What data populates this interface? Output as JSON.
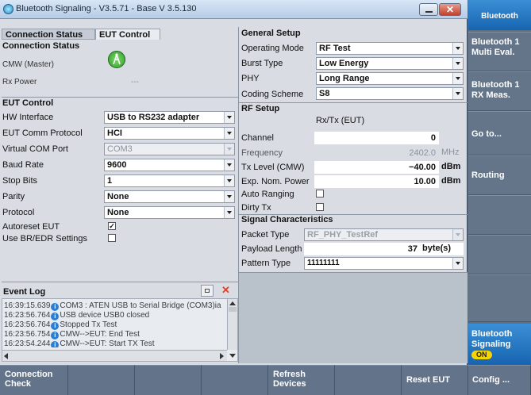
{
  "window": {
    "title": "Bluetooth Signaling  - V3.5.71 - Base V 3.5.130"
  },
  "tabs": [
    {
      "label": "Connection Status"
    },
    {
      "label": "EUT Control"
    }
  ],
  "connection_status": {
    "heading": "Connection Status",
    "cmw_label": "CMW (Master)",
    "rx_power_label": "Rx Power",
    "rx_power_value": "---"
  },
  "eut_control": {
    "heading": "EUT Control",
    "fields": [
      {
        "label": "HW Interface",
        "value": "USB to RS232 adapter"
      },
      {
        "label": "EUT Comm Protocol",
        "value": "HCI"
      },
      {
        "label": "Virtual COM Port",
        "value": "COM3"
      },
      {
        "label": "Baud Rate",
        "value": "9600"
      },
      {
        "label": "Stop Bits",
        "value": "1"
      },
      {
        "label": "Parity",
        "value": "None"
      },
      {
        "label": "Protocol",
        "value": "None"
      }
    ],
    "autoreset_label": "Autoreset EUT",
    "autoreset_checked": true,
    "br_edr_label": "Use BR/EDR Settings",
    "br_edr_checked": false
  },
  "event_log": {
    "heading": "Event Log",
    "lines": [
      {
        "time": "16:39:15.639",
        "text": "COM3 : ATEN USB to Serial Bridge (COM3)ia"
      },
      {
        "time": "16:23:56.764",
        "text": "USB device USB0 closed"
      },
      {
        "time": "16:23:56.764",
        "text": "Stopped Tx Test"
      },
      {
        "time": "16:23:56.754",
        "text": "CMW-->EUT: End Test"
      },
      {
        "time": "16:23:54.244",
        "text": "CMW-->EUT: Start TX Test"
      }
    ]
  },
  "general_setup": {
    "heading": "General Setup",
    "fields": [
      {
        "label": "Operating Mode",
        "value": "RF Test"
      },
      {
        "label": "Burst Type",
        "value": "Low Energy"
      },
      {
        "label": "PHY",
        "value": "Long Range"
      },
      {
        "label": "Coding Scheme",
        "value": "S8"
      }
    ]
  },
  "rf_setup": {
    "heading": "RF Setup",
    "column_header": "Rx/Tx (EUT)",
    "channel_label": "Channel",
    "channel_value": "0",
    "frequency_label": "Frequency",
    "frequency_value": "2402.0",
    "frequency_unit": "MHz",
    "tx_level_label": "Tx Level (CMW)",
    "tx_level_value": "−40.00",
    "tx_level_unit": "dBm",
    "exp_power_label": "Exp. Nom. Power",
    "exp_power_value": "10.00",
    "exp_power_unit": "dBm",
    "auto_ranging_label": "Auto Ranging",
    "auto_ranging_checked": false,
    "dirty_tx_label": "Dirty Tx",
    "dirty_tx_checked": false
  },
  "signal_characteristics": {
    "heading": "Signal Characteristics",
    "packet_type_label": "Packet Type",
    "packet_type_value": "RF_PHY_TestRef",
    "payload_length_label": "Payload Length",
    "payload_length_value": "37",
    "payload_length_unit": "byte(s)",
    "pattern_type_label": "Pattern Type",
    "pattern_type_value": "11111111"
  },
  "sidebar": {
    "header": "Bluetooth",
    "items": [
      {
        "label": "Bluetooth 1 Multi Eval."
      },
      {
        "label": "Bluetooth 1 RX Meas."
      },
      {
        "label": "Go to..."
      },
      {
        "label": "Routing"
      },
      {
        "label": "Bluetooth Signaling",
        "badge": "ON"
      }
    ]
  },
  "softkeys": [
    {
      "label": "Connection Check"
    },
    {
      "label": ""
    },
    {
      "label": ""
    },
    {
      "label": ""
    },
    {
      "label": "Refresh Devices"
    },
    {
      "label": ""
    },
    {
      "label": "Reset EUT"
    },
    {
      "label": "Config ..."
    }
  ],
  "colors": {
    "accent": "#1a6fbf",
    "badge": "#f5d400",
    "close": "#c8462f"
  }
}
